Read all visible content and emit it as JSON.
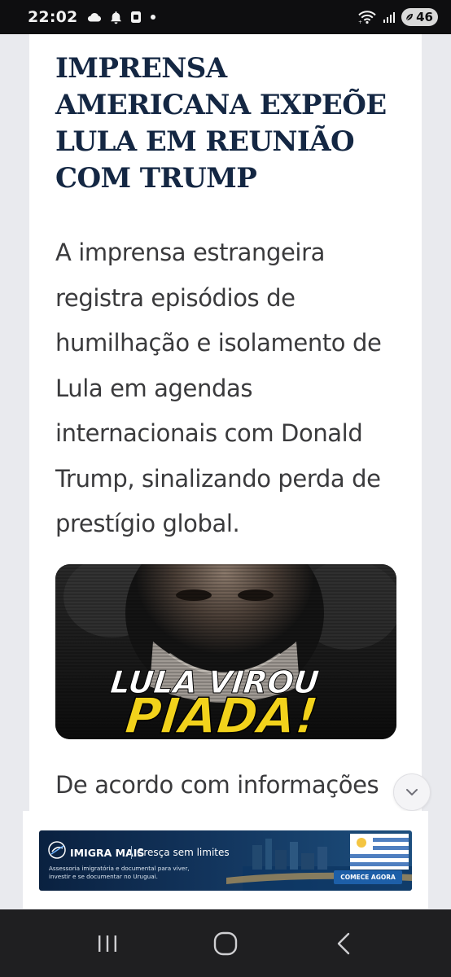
{
  "status_bar": {
    "time": "22:02",
    "battery": "46",
    "icons_left": [
      "cloud-icon",
      "bell-icon",
      "app-notification-icon",
      "dot-icon"
    ],
    "icons_right": [
      "wifi-icon",
      "signal-icon",
      "battery-icon"
    ]
  },
  "article": {
    "headline": "IMPRENSA AMERICANA EXPEÕE LULA EM REUNIÃO COM TRUMP",
    "lead": "A imprensa estrangeira registra episódios de humilhação e isolamento de Lula em agendas internacionais com Donald Trump, sinalizando perda de prestígio global.",
    "image_text_line1": "LULA VIROU",
    "image_text_line2": "PIADA!",
    "continued_text": "De acordo com informações"
  },
  "ad": {
    "brand": "IMIGRA MAIS",
    "slogan": "Cresça sem limites",
    "description": "Assessoria imigratória e documental para viver, investir e se documentar no Uruguai.",
    "cta": "COMECE AGORA"
  },
  "nav": {
    "buttons": [
      "recent-apps",
      "home",
      "back"
    ]
  },
  "colors": {
    "headline": "#142743",
    "body_text": "#3a3a3c",
    "page_background": "#e9eaee",
    "image_highlight": "#f2d21b"
  }
}
